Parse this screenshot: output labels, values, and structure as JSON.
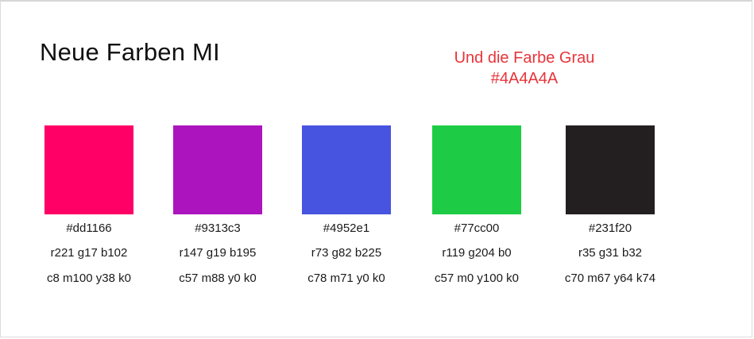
{
  "title": "Neue Farben MI",
  "note": {
    "line1": "Und die Farbe Grau",
    "line2": "#4A4A4A",
    "color": "#e8343a"
  },
  "swatches": [
    {
      "color": "#ff0066",
      "hex": "#dd1166",
      "rgb": "r221 g17 b102",
      "cmyk": "c8 m100 y38 k0"
    },
    {
      "color": "#ac14be",
      "hex": "#9313c3",
      "rgb": "r147 g19 b195",
      "cmyk": "c57 m88 y0 k0"
    },
    {
      "color": "#4654df",
      "hex": "#4952e1",
      "rgb": "r73 g82 b225",
      "cmyk": "c78 m71 y0 k0"
    },
    {
      "color": "#1dcc44",
      "hex": "#77cc00",
      "rgb": "r119 g204 b0",
      "cmyk": "c57 m0 y100 k0"
    },
    {
      "color": "#231f20",
      "hex": "#231f20",
      "rgb": "r35 g31 b32",
      "cmyk": "c70 m67 y64 k74"
    }
  ]
}
